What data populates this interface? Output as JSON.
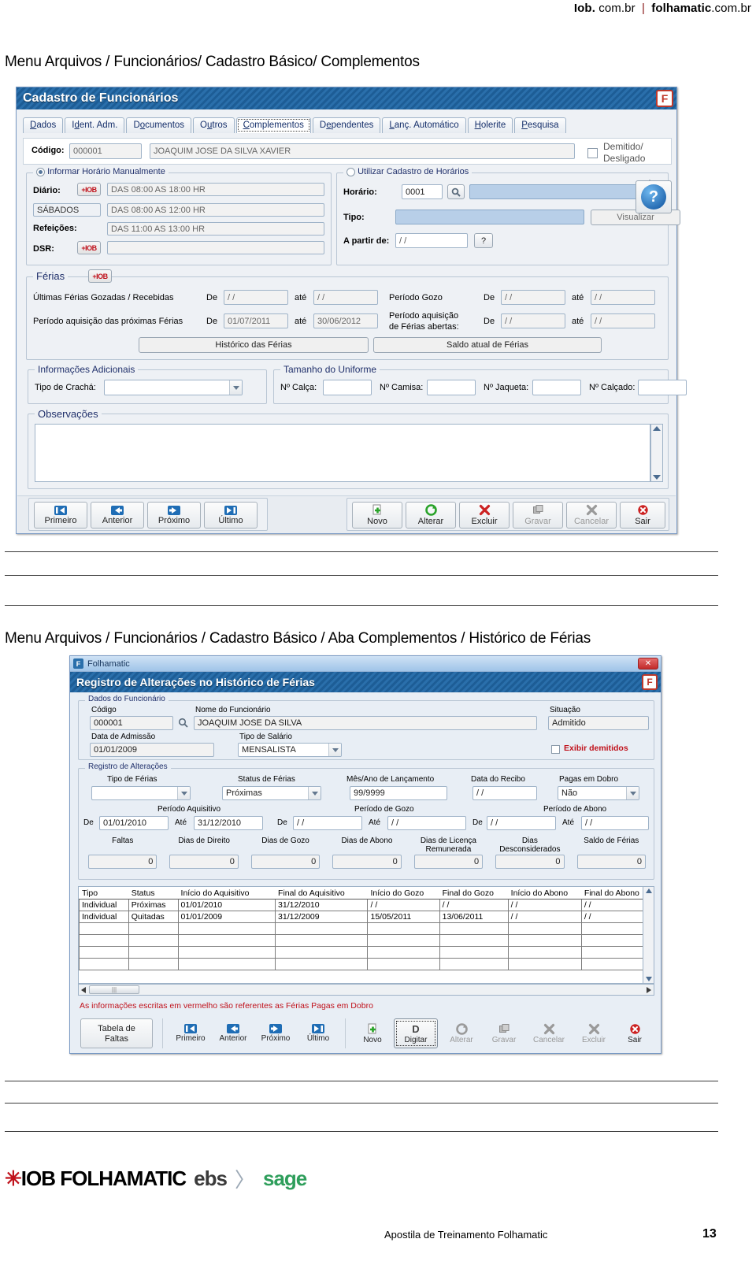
{
  "brand": {
    "left": "Iob.",
    "left_suffix": "com.br",
    "sep": "|",
    "right": "folhamatic",
    "right_suffix": ".com.br"
  },
  "breadcrumbs": {
    "first": "Menu Arquivos / Funcionários/ Cadastro Básico/ Complementos",
    "second": "Menu Arquivos / Funcionários / Cadastro Básico / Aba  Complementos / Histórico de Férias"
  },
  "window1": {
    "title": "Cadastro de Funcionários",
    "badge": "F",
    "tabs": [
      {
        "label": "Dados",
        "active": false
      },
      {
        "label": "Ident. Adm.",
        "active": false
      },
      {
        "label": "Documentos",
        "active": false
      },
      {
        "label": "Outros",
        "active": false
      },
      {
        "label": "Complementos",
        "active": true
      },
      {
        "label": "Dependentes",
        "active": false
      },
      {
        "label": "Lanç. Automático",
        "active": false
      },
      {
        "label": "Holerite",
        "active": false
      },
      {
        "label": "Pesquisa",
        "active": false
      }
    ],
    "codigo_label": "Código:",
    "codigo_value": "000001",
    "nome_value": "JOAQUIM JOSE DA SILVA XAVIER",
    "demitido_label_1": "Demitido/",
    "demitido_label_2": "Desligado",
    "manual": {
      "legend": "Informar Horário Manualmente",
      "rows": [
        {
          "label": "Diário:",
          "iob": true,
          "value": "DAS 08:00 AS 18:00 HR"
        },
        {
          "label": "SÁBADOS",
          "iob": false,
          "boxed": true,
          "value": "DAS 08:00 AS 12:00 HR"
        },
        {
          "label": "Refeições:",
          "iob": false,
          "value": "DAS 11:00 AS 13:00 HR"
        },
        {
          "label": "DSR:",
          "iob": true,
          "value": ""
        }
      ]
    },
    "cadastro": {
      "legend": "Utilizar Cadastro de Horários",
      "horario_label": "Horário:",
      "horario_value": "0001",
      "horario_desc": "",
      "tipo_label": "Tipo:",
      "tipo_value": "",
      "visualizar": "Visualizar",
      "apartir_label": "A partir de:",
      "apartir_value": "/ /",
      "help_btn": "?",
      "help_big": "?"
    },
    "ferias": {
      "legend": "Férias",
      "row1_label": "Últimas Férias Gozadas / Recebidas",
      "row2_label": "Período aquisição das próximas Férias",
      "de": "De",
      "ate": "até",
      "r1_de": "/ /",
      "r1_ate": "/ /",
      "r2_de": "01/07/2011",
      "r2_ate": "30/06/2012",
      "gozo_label": "Período Gozo",
      "gozo_de": "/ /",
      "gozo_ate": "/ /",
      "abertas_label_1": "Período aquisição",
      "abertas_label_2": "de Férias abertas:",
      "abertas_de": "/ /",
      "abertas_ate": "/ /",
      "btn_historico": "Histórico das Férias",
      "btn_saldo": "Saldo atual de Férias"
    },
    "adicionais": {
      "legend": "Informações Adicionais",
      "cracha_label": "Tipo de Crachá:",
      "cracha_value": ""
    },
    "uniforme": {
      "legend": "Tamanho do Uniforme",
      "calca_label": "Nº Calça:",
      "calca_value": "",
      "camisa_label": "Nº Camisa:",
      "camisa_value": "",
      "jaqueta_label": "Nº Jaqueta:",
      "jaqueta_value": "",
      "calcado_label": "Nº Calçado:",
      "calcado_value": ""
    },
    "observacoes": {
      "legend": "Observações",
      "value": ""
    },
    "nav_buttons": [
      {
        "label": "Primeiro",
        "icon": "first-icon"
      },
      {
        "label": "Anterior",
        "icon": "prev-icon"
      },
      {
        "label": "Próximo",
        "icon": "next-icon"
      },
      {
        "label": "Último",
        "icon": "last-icon"
      }
    ],
    "action_buttons": [
      {
        "label": "Novo",
        "icon": "new-icon",
        "disabled": false
      },
      {
        "label": "Alterar",
        "icon": "edit-icon",
        "disabled": false
      },
      {
        "label": "Excluir",
        "icon": "delete-icon",
        "disabled": false
      },
      {
        "label": "Gravar",
        "icon": "save-icon",
        "disabled": true
      },
      {
        "label": "Cancelar",
        "icon": "cancel-icon",
        "disabled": true
      },
      {
        "label": "Sair",
        "icon": "exit-icon",
        "disabled": false
      }
    ]
  },
  "window2": {
    "app_title": "Folhamatic",
    "close_label": "✕",
    "title": "Registro de Alterações no Histórico de Férias",
    "badge": "F",
    "dados": {
      "legend": "Dados do Funcionário",
      "codigo_label": "Código",
      "codigo_value": "000001",
      "nome_label": "Nome do Funcionário",
      "nome_value": "JOAQUIM JOSE DA SILVA",
      "situacao_label": "Situação",
      "situacao_value": "Admitido",
      "admissao_label": "Data de Admissão",
      "admissao_value": "01/01/2009",
      "salario_label": "Tipo de Salário",
      "salario_value": "MENSALISTA",
      "exibir_demitidos": "Exibir demitidos"
    },
    "registro": {
      "legend": "Registro de Alterações",
      "tipo_label": "Tipo de Férias",
      "tipo_value": "",
      "status_label": "Status de Férias",
      "status_value": "Próximas",
      "mesano_label": "Mês/Ano de Lançamento",
      "mesano_value": "99/9999",
      "recibo_label": "Data do Recibo",
      "recibo_value": "/ /",
      "dobro_label": "Pagas em Dobro",
      "dobro_value": "Não",
      "aquisitivo_label": "Período Aquisitivo",
      "gozo_label": "Período de Gozo",
      "abono_label": "Período de Abono",
      "de": "De",
      "ate": "Até",
      "aq_de": "01/01/2010",
      "aq_ate": "31/12/2010",
      "gz_de": "/ /",
      "gz_ate": "/ /",
      "ab_de": "/ /",
      "ab_ate": "/ /",
      "counters": [
        {
          "label": "Faltas",
          "label2": "",
          "value": "0"
        },
        {
          "label": "Dias de Direito",
          "label2": "",
          "value": "0"
        },
        {
          "label": "Dias de Gozo",
          "label2": "",
          "value": "0"
        },
        {
          "label": "Dias de Abono",
          "label2": "",
          "value": "0"
        },
        {
          "label": "Dias de Licença",
          "label2": "Remunerada",
          "value": "0"
        },
        {
          "label": "Dias",
          "label2": "Desconsiderados",
          "value": "0"
        },
        {
          "label": "Saldo de Férias",
          "label2": "",
          "value": "0"
        }
      ]
    },
    "table": {
      "columns": [
        "Tipo",
        "Status",
        "Início do Aquisitivo",
        "Final do Aquisitivo",
        "Início do Gozo",
        "Final do Gozo",
        "Início do Abono",
        "Final do Abono"
      ],
      "rows": [
        [
          "Individual",
          "Próximas",
          "01/01/2010",
          "31/12/2010",
          "/ /",
          "/ /",
          "/ /",
          "/ /"
        ],
        [
          "Individual",
          "Quitadas",
          "01/01/2009",
          "31/12/2009",
          "15/05/2011",
          "13/06/2011",
          "/ /",
          "/ /"
        ],
        [
          "",
          "",
          "",
          "",
          "",
          "",
          "",
          ""
        ],
        [
          "",
          "",
          "",
          "",
          "",
          "",
          "",
          ""
        ],
        [
          "",
          "",
          "",
          "",
          "",
          "",
          "",
          ""
        ],
        [
          "",
          "",
          "",
          "",
          "",
          "",
          "",
          ""
        ]
      ]
    },
    "note": "As informações escritas em vermelho são referentes as Férias Pagas em Dobro",
    "tabela_faltas_1": "Tabela de",
    "tabela_faltas_2": "Faltas",
    "nav_buttons": [
      {
        "label": "Primeiro",
        "icon": "first-icon"
      },
      {
        "label": "Anterior",
        "icon": "prev-icon"
      },
      {
        "label": "Próximo",
        "icon": "next-icon"
      },
      {
        "label": "Último",
        "icon": "last-icon"
      }
    ],
    "action_buttons": [
      {
        "label": "Novo",
        "icon": "new-icon",
        "disabled": false
      },
      {
        "label": "Digitar",
        "icon": "type-icon",
        "disabled": false,
        "focused": true
      },
      {
        "label": "Alterar",
        "icon": "edit-icon",
        "disabled": true
      },
      {
        "label": "Gravar",
        "icon": "save-icon",
        "disabled": true
      },
      {
        "label": "Cancelar",
        "icon": "cancel-icon",
        "disabled": true
      },
      {
        "label": "Excluir",
        "icon": "delete-icon",
        "disabled": true
      },
      {
        "label": "Sair",
        "icon": "exit-icon",
        "disabled": false
      }
    ]
  },
  "footer": {
    "text": "Apostila de Treinamento  Folhamatic",
    "page": "13"
  },
  "logos": {
    "iob": "IOB FOLHAMATIC",
    "ebs": "ebs",
    "chev": "〉",
    "sage": "sage"
  },
  "colors": {
    "title_blue": "#205d95",
    "accent_red": "#c0111b",
    "label_navy": "#20306b",
    "field_blue": "#b8cfe8"
  }
}
